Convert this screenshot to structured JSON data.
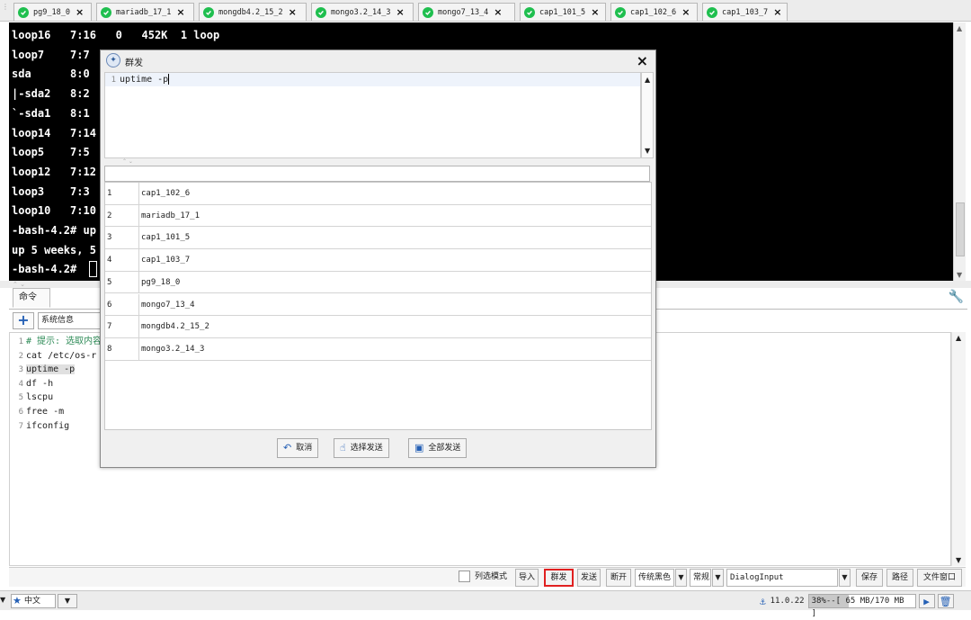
{
  "tabs": [
    {
      "label": "pg9_18_0"
    },
    {
      "label": "mariadb_17_1"
    },
    {
      "label": "mongdb4.2_15_2"
    },
    {
      "label": "mongo3.2_14_3"
    },
    {
      "label": "mongo7_13_4"
    },
    {
      "label": "cap1_101_5"
    },
    {
      "label": "cap1_102_6"
    },
    {
      "label": "cap1_103_7"
    }
  ],
  "terminal": {
    "lines": [
      "loop16   7:16   0   452K  1 loop",
      "loop7    7:7",
      "sda      8:0",
      "|-sda2   8:2",
      "`-sda1   8:1",
      "loop14   7:14",
      "loop5    7:5",
      "loop12   7:12",
      "loop3    7:3",
      "loop10   7:10",
      "-bash-4.2# up",
      "up 5 weeks, 5",
      "-bash-4.2#"
    ]
  },
  "dialog": {
    "title": "群发",
    "close": "×",
    "editor_line_number": "1",
    "editor_text": "uptime -p",
    "filter_value": "",
    "rows": [
      {
        "index": "1",
        "name": "cap1_102_6"
      },
      {
        "index": "2",
        "name": "mariadb_17_1"
      },
      {
        "index": "3",
        "name": "cap1_101_5"
      },
      {
        "index": "4",
        "name": "cap1_103_7"
      },
      {
        "index": "5",
        "name": "pg9_18_0"
      },
      {
        "index": "6",
        "name": "mongo7_13_4"
      },
      {
        "index": "7",
        "name": "mongdb4.2_15_2"
      },
      {
        "index": "8",
        "name": "mongo3.2_14_3"
      }
    ],
    "buttons": {
      "cancel": "取消",
      "send_selected": "选择发送",
      "send_all": "全部发送"
    }
  },
  "command_panel": {
    "tab": "命令",
    "add": "+",
    "category": "系统信息",
    "lines": [
      {
        "n": "1",
        "text": "# 提示: 选取内容",
        "type": "comment"
      },
      {
        "n": "2",
        "text": "cat /etc/os-r",
        "type": "normal"
      },
      {
        "n": "3",
        "text": "uptime -p",
        "type": "selected"
      },
      {
        "n": "4",
        "text": "df -h",
        "type": "normal"
      },
      {
        "n": "5",
        "text": "lscpu",
        "type": "normal"
      },
      {
        "n": "6",
        "text": "free -m",
        "type": "normal"
      },
      {
        "n": "7",
        "text": "ifconfig",
        "type": "normal"
      }
    ]
  },
  "button_bar": {
    "column_mode": "列选模式",
    "import": "导入",
    "broadcast": "群发",
    "send": "发送",
    "disconnect": "断开",
    "theme": "传统黑色",
    "style": "常规",
    "font": "DialogInput",
    "save": "保存",
    "path": "路径",
    "file_window": "文件窗口"
  },
  "status": {
    "language": "中文",
    "ip": "11.0.22",
    "memory_text": "38%--[ 65 MB/170 MB ]",
    "memory_percent": 38
  },
  "colors": {
    "ok_green": "#1fbf4f",
    "highlight_red": "#e02020",
    "accent_blue": "#2560b5"
  }
}
